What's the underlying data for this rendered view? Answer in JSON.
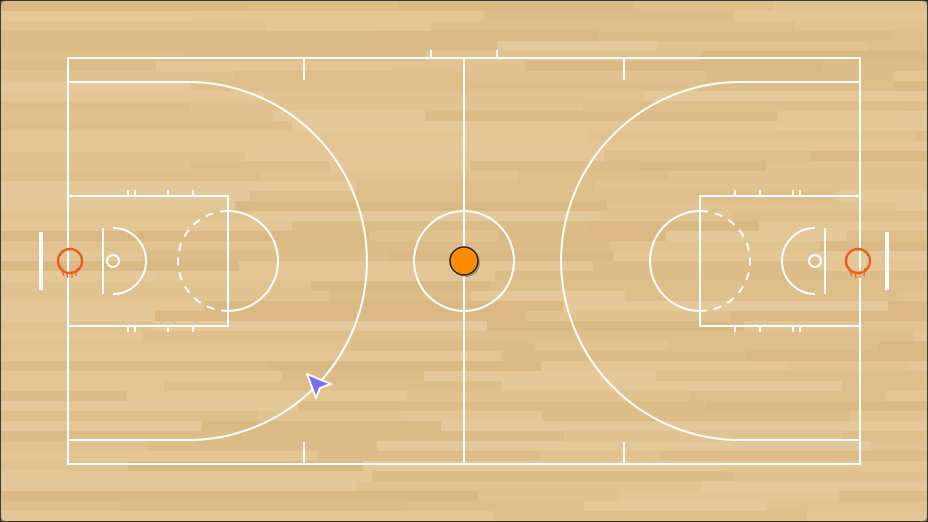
{
  "court": {
    "floor_color": "#dfc08e",
    "plank_colors": [
      "#e6c99c",
      "#d9b985",
      "#e2c393",
      "#d5b37e",
      "#e8cea3",
      "#dcbd89"
    ],
    "line_color": "#ffffff",
    "frame_color": "#3a3a3a"
  },
  "ball": {
    "color": "#ff8c00",
    "outline": "#222222",
    "state": "center-circle"
  },
  "rims": {
    "color": "#e8601c"
  },
  "cursor": {
    "color": "#7b6cf0",
    "icon": "pointer-arrow-icon"
  }
}
